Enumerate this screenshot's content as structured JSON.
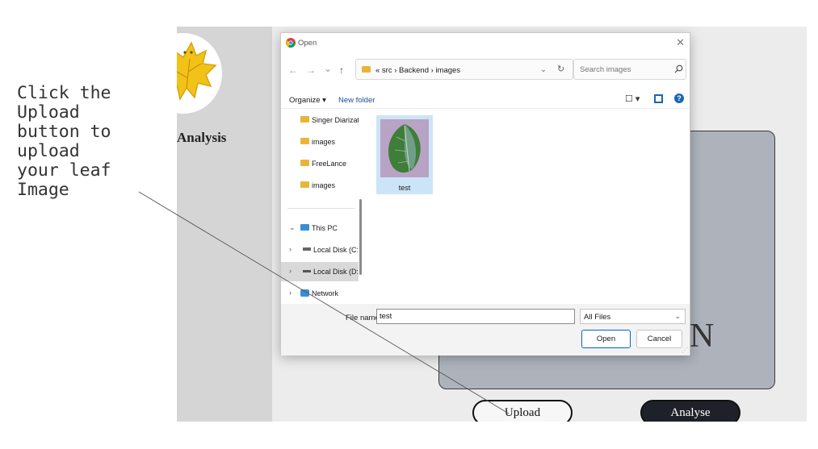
{
  "annotation": {
    "text": "Click the\nUpload\nbutton to\nupload\nyour leaf\nImage"
  },
  "app": {
    "title": "Analysis",
    "preview_char": "N",
    "upload_label": "Upload",
    "analyse_label": "Analyse"
  },
  "dialog": {
    "title": "Open",
    "close_icon": "✕",
    "nav": {
      "back": "←",
      "forward": "→",
      "recent": "⌄",
      "up": "↑"
    },
    "address": {
      "path": "« src › Backend › images",
      "dropdown": "⌄",
      "refresh": "↻"
    },
    "search": {
      "placeholder": "Search images"
    },
    "toolbar": {
      "organize": "Organize ▾",
      "new_folder": "New folder",
      "view": "☐ ▾",
      "help": "?"
    },
    "nav_items": [
      {
        "label": "Singer Diarizatic",
        "icon": "folder-icon"
      },
      {
        "label": "images",
        "icon": "folder-icon"
      },
      {
        "label": "FreeLance",
        "icon": "folder-icon"
      },
      {
        "label": "images",
        "icon": "folder-icon"
      },
      {
        "label": "This PC",
        "icon": "monitor-icon",
        "chevron": "⌄"
      },
      {
        "label": "Local Disk (C:)",
        "icon": "drive-icon",
        "chevron": "›"
      },
      {
        "label": "Local Disk (D:)",
        "icon": "drive-icon",
        "chevron": "›"
      },
      {
        "label": "Network",
        "icon": "network-icon",
        "chevron": "›"
      }
    ],
    "file": {
      "name": "test"
    },
    "footer": {
      "filename_label": "File name:",
      "filename_value": "test",
      "filetype": "All Files",
      "open_label": "Open",
      "cancel_label": "Cancel"
    }
  },
  "colors": {
    "accent": "#0067c0",
    "selection": "#cce4f7",
    "folder": "#e8b53a",
    "analyse_bg": "#1e2228"
  }
}
